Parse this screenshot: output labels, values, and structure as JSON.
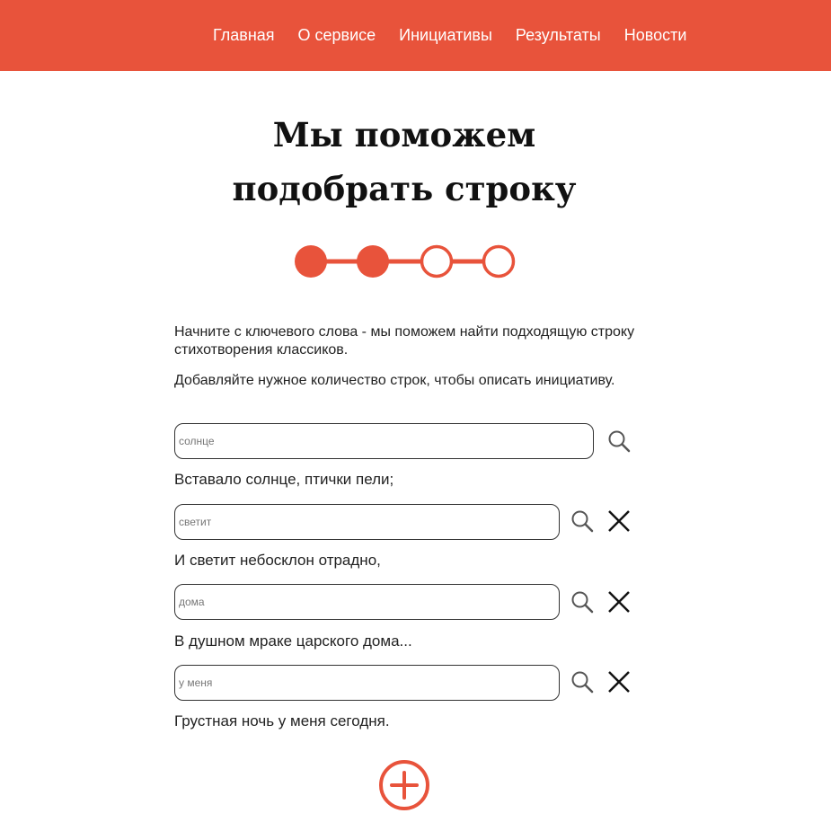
{
  "nav": {
    "items": [
      "Главная",
      "О сервисе",
      "Инициативы",
      "Результаты",
      "Новости"
    ]
  },
  "title": {
    "line1": "Мы поможем",
    "line2": "подобрать строку"
  },
  "progress": {
    "total_steps": 4,
    "completed_steps": 2
  },
  "intro": {
    "p1": "Начните с ключевого слова - мы поможем найти подходящую строку стихотворения классиков.",
    "p2": "Добавляйте нужное количество строк, чтобы описать инициативу."
  },
  "rows": [
    {
      "keyword": "солнце",
      "result": "Вставало солнце, птички пели;",
      "removable": false
    },
    {
      "keyword": "светит",
      "result": "И светит небосклон отрадно,",
      "removable": true
    },
    {
      "keyword": "дома",
      "result": "В душном мраке царского дома...",
      "removable": true
    },
    {
      "keyword": "у меня",
      "result": "Грустная ночь у меня сегодня.",
      "removable": true
    }
  ],
  "icons": {
    "search": "search-icon",
    "remove": "close-icon",
    "add": "plus-circle-icon"
  },
  "colors": {
    "accent": "#e8533b",
    "text": "#1a1a1a",
    "nav_text": "#ffffff"
  }
}
